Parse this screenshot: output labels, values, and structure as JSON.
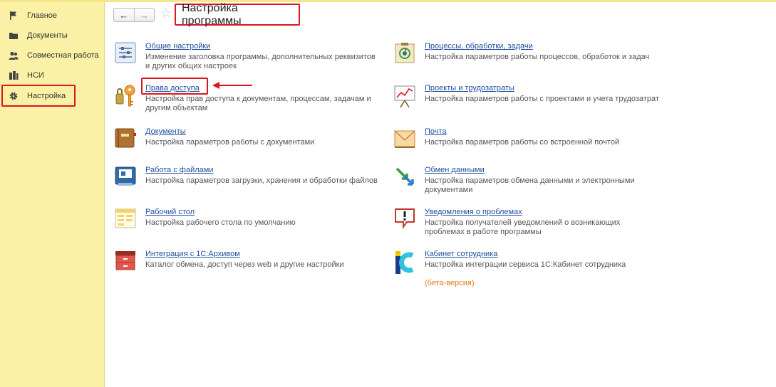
{
  "sidebar": {
    "items": [
      {
        "label": "Главное",
        "icon": "flag-icon"
      },
      {
        "label": "Документы",
        "icon": "folder-icon"
      },
      {
        "label": "Совместная работа",
        "icon": "users-icon"
      },
      {
        "label": "НСИ",
        "icon": "books-icon"
      },
      {
        "label": "Настройка",
        "icon": "gear-icon",
        "active": true
      }
    ]
  },
  "header": {
    "back": "←",
    "forward": "→",
    "favorite": "☆",
    "title": "Настройка программы"
  },
  "sections": {
    "left": [
      {
        "link": "Общие настройки",
        "desc": "Изменение заголовка программы, дополнительных реквизитов и других общих настроек",
        "icon": "sliders-icon"
      },
      {
        "link": "Права доступа",
        "desc": "Настройка прав доступа к документам, процессам, задачам и другим объектам",
        "icon": "key-lock-icon"
      },
      {
        "link": "Документы",
        "desc": "Настройка параметров работы с документами",
        "icon": "document-folder-icon"
      },
      {
        "link": "Работа с файлами",
        "desc": "Настройка параметров загрузки, хранения и обработки файлов",
        "icon": "file-tray-icon"
      },
      {
        "link": "Рабочий стол",
        "desc": "Настройка рабочего стола по умолчанию",
        "icon": "desktop-table-icon"
      },
      {
        "link": "Интеграция с 1С:Архивом",
        "desc": "Каталог обмена, доступ через web и другие настройки",
        "icon": "archive-cabinet-icon"
      }
    ],
    "right": [
      {
        "link": "Процессы, обработки, задачи",
        "desc": "Настройка параметров работы процессов, обработок и задач",
        "icon": "process-icon"
      },
      {
        "link": "Проекты и трудозатраты",
        "desc": "Настройка параметров работы с проектами и учета трудозатрат",
        "icon": "chart-board-icon"
      },
      {
        "link": "Почта",
        "desc": "Настройка параметров работы со встроенной почтой",
        "icon": "mail-icon"
      },
      {
        "link": "Обмен данными",
        "desc": "Настройка параметров обмена данными и электронными документами",
        "icon": "exchange-arrows-icon"
      },
      {
        "link": "Уведомления о проблемах",
        "desc": "Настройка получателей уведомлений о возникающих проблемах в работе программы",
        "icon": "warning-message-icon"
      },
      {
        "link": "Кабинет сотрудника",
        "desc": "Настройка интеграции сервиса 1С:Кабинет сотрудника",
        "extra": "(бета-версия)",
        "icon": "cabinet-logo-icon"
      }
    ]
  },
  "colors": {
    "sidebar_bg": "#fbf1a6",
    "link": "#1f4f9e",
    "highlight": "#d9171e",
    "beta": "#e07b1a"
  }
}
